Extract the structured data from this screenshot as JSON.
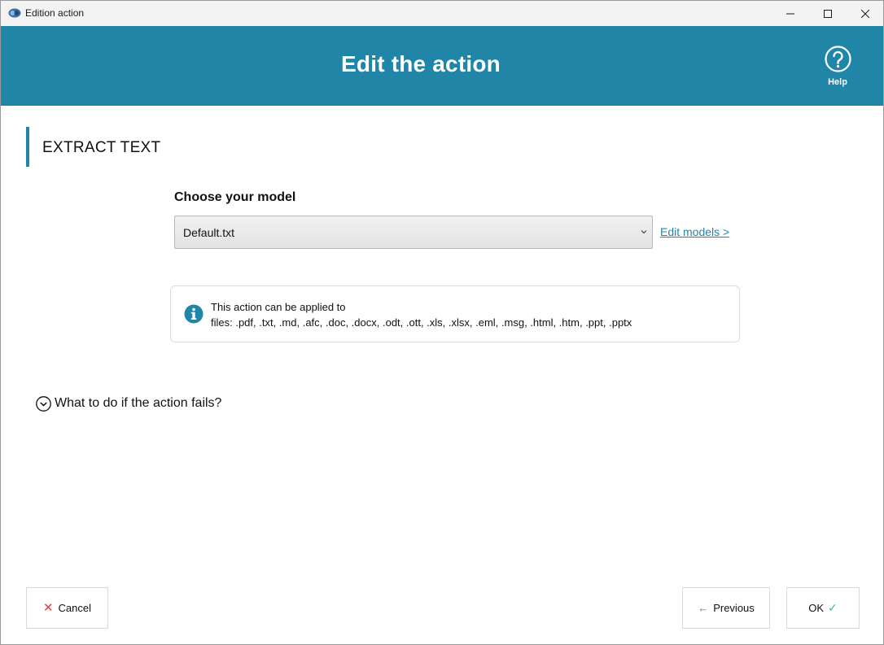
{
  "window": {
    "title": "Edition action"
  },
  "header": {
    "title": "Edit the action",
    "help_label": "Help"
  },
  "section": {
    "title": "EXTRACT TEXT"
  },
  "model": {
    "label": "Choose your model",
    "selected": "Default.txt",
    "edit_link": "Edit models >"
  },
  "info": {
    "line1": "This action can be applied to",
    "line2": "files: .pdf, .txt, .md, .afc, .doc, .docx, .odt, .ott, .xls, .xlsx, .eml, .msg, .html, .htm, .ppt, .pptx"
  },
  "failure": {
    "label": "What to do if the action fails?"
  },
  "footer": {
    "cancel_label": "Cancel",
    "previous_label": "Previous",
    "ok_label": "OK"
  },
  "icons": {
    "app": "app-icon",
    "minimize": "minimize-icon",
    "maximize": "maximize-icon",
    "close": "close-icon",
    "help": "help-circle-icon",
    "info": "info-icon",
    "chevron": "chevron-down-icon",
    "cancel": "x-icon",
    "previous": "arrow-left-icon",
    "ok": "check-icon"
  },
  "colors": {
    "accent": "#2185a7",
    "cancel": "#e04343",
    "ok": "#3bb78f"
  }
}
